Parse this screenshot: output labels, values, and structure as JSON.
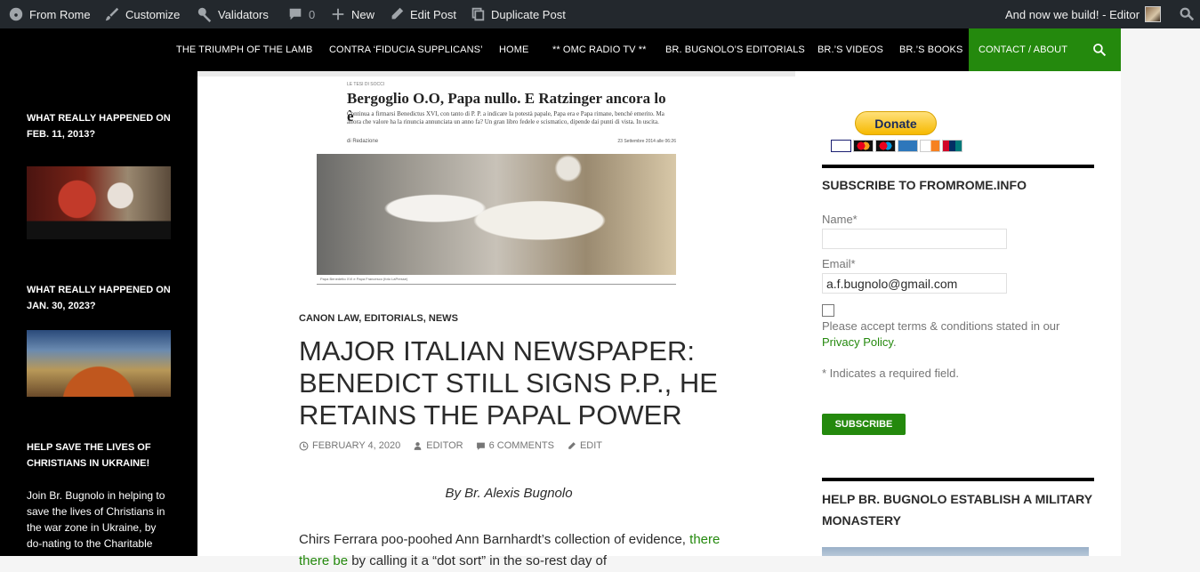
{
  "adminbar": {
    "site": "From Rome",
    "customize": "Customize",
    "validators": "Validators",
    "comments_count": "0",
    "new": "New",
    "edit_post": "Edit Post",
    "duplicate_post": "Duplicate Post",
    "greeting": "And now we build! - Editor"
  },
  "nav": {
    "items": [
      "THE TRIUMPH OF THE LAMB",
      "CONTRA ‘FIDUCIA SUPPLICANS’",
      "HOME",
      "** OMC RADIO TV **",
      "BR. BUGNOLO’S EDITORIALS",
      "BR.’S VIDEOS",
      "BR.’S BOOKS",
      "CONTACT / ABOUT"
    ],
    "accent": "#24890d"
  },
  "leftbar": {
    "widget1_title": "WHAT REALLY HAPPENED ON FEB. 11, 2013?",
    "widget2_title": "WHAT REALLY HAPPENED ON JAN. 30, 2023?",
    "widget3_title": "HELP SAVE THE LIVES OF CHRISTIANS IN UKRAINE!",
    "widget3_text": "Join Br. Bugnolo in helping to save the lives of Christians in the war zone in Ukraine, by do-nating to the Charitable"
  },
  "clip": {
    "kicker": "LE TESI DI SOCCI",
    "title": "Bergoglio O.O, Papa nullo. E Ratzinger ancora lo è",
    "subtitle": "Continua a firmarsi Benedictus XVI, con tanto di P. P. a indicare la potestà papale, Papa era e Papa rimane, benché emerito. Ma allora che valore ha la rinuncia annunciata un anno fa? Un gran libro fedele e scismatico, dipende dai punti di vista. In uscita.",
    "byline": "di Redazione",
    "date": "23 Settembre 2014 alle 06:26",
    "caption": "Papa Benedetto XVI e Papa Francesco (foto LaPresse)"
  },
  "post": {
    "categories": [
      "CANON LAW",
      "EDITORIALS",
      "NEWS"
    ],
    "title": "MAJOR ITALIAN NEWSPAPER: BENEDICT STILL SIGNS P.P., HE RETAINS THE PAPAL POWER",
    "date": "FEBRUARY 4, 2020",
    "author": "EDITOR",
    "comments": "6 COMMENTS",
    "edit": "EDIT",
    "byline": "By Br. Alexis Bugnolo",
    "body_start": "Chirs Ferrara poo-poohed Ann Barnhardt’s collection of evidence,",
    "body_link": "there there be",
    "body_rest": " by calling it a “dot sort” in the so-rest day of"
  },
  "rightbar": {
    "donate_label": "Donate",
    "subscribe_title": "SUBSCRIBE TO FROMROME.INFO",
    "name_label": "Name*",
    "name_value": "",
    "email_label": "Email*",
    "email_value": "a.f.bugnolo@gmail.com",
    "terms_text": "Please accept terms & conditions stated in our",
    "privacy_link": "Privacy Policy",
    "required_note": "* Indicates a required field.",
    "subscribe_button": "SUBSCRIBE",
    "military_title": "HELP BR. BUGNOLO ESTABLISH A MILITARY MONASTERY"
  }
}
